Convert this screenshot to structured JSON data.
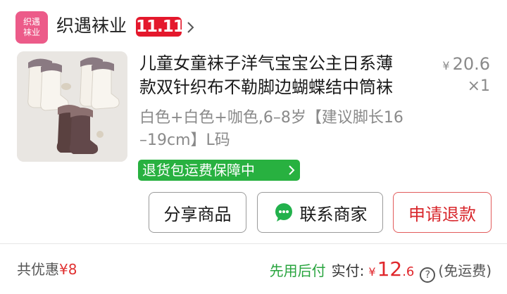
{
  "shop": {
    "logo_line1": "织遇",
    "logo_line2": "袜业",
    "name": "织遇袜业",
    "badge": "11.11"
  },
  "product": {
    "title_line1": "儿童女童袜子洋气宝宝公主日系薄",
    "title_line2": "款双针织布不勒脚边蝴蝶结中筒袜",
    "price_currency": "¥",
    "price": "20.6",
    "quantity": "×1",
    "spec_line1": "白色+白色+咖色,6–8岁【建议脚长16",
    "spec_line2": "–19cm】L码",
    "return_tag": "退货包运费保障中"
  },
  "actions": {
    "share": "分享商品",
    "contact": "联系商家",
    "refund": "申请退款"
  },
  "footer": {
    "discount_label": "共优惠",
    "discount_value": "¥8",
    "pay_later": "先用后付",
    "paid_label": "实付:",
    "paid_currency": "¥",
    "paid_int": "12",
    "paid_dec": ".6",
    "help_icon": "?",
    "free_shipping": "(免运费)"
  },
  "colors": {
    "accent_red": "#e4182c",
    "logo_pink": "#ec5b89",
    "green": "#28b140"
  }
}
